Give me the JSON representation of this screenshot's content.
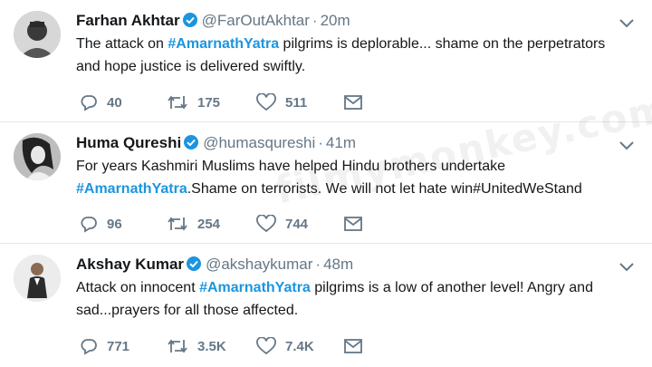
{
  "colors": {
    "accent": "#1b95e0",
    "text": "#14171a",
    "muted": "#657786",
    "divider": "#e1e8ed"
  },
  "watermark": "filmymonkey.com",
  "tweets": [
    {
      "name": "Farhan Akhtar",
      "handle": "@FarOutAkhtar",
      "time": "20m",
      "text": [
        "The attack on ",
        "#AmarnathYatra",
        " pilgrims is deplorable... shame on the perpetrators and hope justice is delivered swiftly."
      ],
      "replies": "40",
      "retweets": "175",
      "likes": "511"
    },
    {
      "name": "Huma Qureshi",
      "handle": "@humasqureshi",
      "time": "41m",
      "text": [
        "For years Kashmiri Muslims have helped Hindu brothers undertake ",
        "#AmarnathYatra",
        ".Shame on terrorists. We will not let hate win#UnitedWeStand"
      ],
      "replies": "96",
      "retweets": "254",
      "likes": "744"
    },
    {
      "name": "Akshay Kumar",
      "handle": "@akshaykumar",
      "time": "48m",
      "text": [
        "Attack on innocent ",
        "#AmarnathYatra",
        " pilgrims is a low of another level! Angry and sad...prayers for all those affected."
      ],
      "replies": "771",
      "retweets": "3.5K",
      "likes": "7.4K"
    }
  ]
}
